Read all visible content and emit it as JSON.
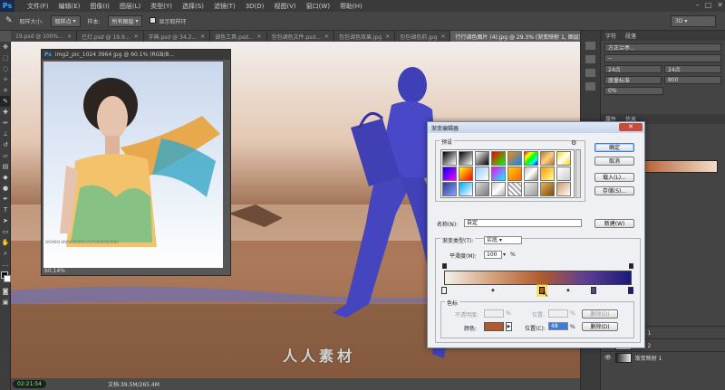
{
  "app": {
    "logo": "Ps"
  },
  "menu": [
    "文件(F)",
    "编辑(E)",
    "图像(I)",
    "图层(L)",
    "类型(Y)",
    "选择(S)",
    "滤镜(T)",
    "3D(D)",
    "视图(V)",
    "窗口(W)",
    "帮助(H)"
  ],
  "window_controls": [
    "–",
    "□",
    "✕"
  ],
  "options_bar": {
    "sample_size_label": "取样大小:",
    "sample_size_value": "取样点",
    "sample_label": "样本:",
    "sample_value": "所有图层",
    "show_ring_label": "显示取样环",
    "workspace_value": "3D"
  },
  "tabs": [
    {
      "label": "19.psd @ 100%..."
    },
    {
      "label": "已灯.psd @ 19.9..."
    },
    {
      "label": "字典.psd @ 34.2..."
    },
    {
      "label": "调色工具.psd..."
    },
    {
      "label": "包包调色文件.psd..."
    },
    {
      "label": "包包调色效果.jpg"
    },
    {
      "label": "包包调色前.jpg"
    },
    {
      "label": "行行调色图片 (4).jpg @ 29.3% (渐变映射 1, 图层蒙版/8)"
    }
  ],
  "floating_doc": {
    "title": "img2_pic_1024 3964 jpg @ 60.1% (RGB/8...",
    "zoom": "60.14%",
    "caption": "WOMEN WWW.WOMO.CC/FASHION/2685"
  },
  "status": {
    "time": "02:21:54",
    "doc_info": "文档:39.5M/265.4M"
  },
  "gradient_editor": {
    "title": "渐变编辑器",
    "presets_label": "预设",
    "ok": "确定",
    "cancel": "取消",
    "load": "载入(L)...",
    "save": "存储(S)...",
    "name_label": "名称(N):",
    "name_value": "自定",
    "new_button": "新建(W)",
    "type_label": "渐变类型(T):",
    "type_value": "实底",
    "smooth_label": "平滑度(M):",
    "smooth_value": "100",
    "smooth_unit": "%",
    "stops_label": "色标",
    "opacity_label": "不透明度:",
    "opacity_unit": "%",
    "location_label": "位置:",
    "location_unit": "%",
    "delete_label": "删除(D)",
    "color_label": "颜色:",
    "color_location_label": "位置(C):",
    "color_location_value": "48",
    "color_location_unit": "%",
    "color_delete_label": "删除(D)",
    "stop_color": "#b05a2e"
  },
  "right_panel": {
    "tabs": [
      "字符",
      "段落"
    ],
    "tabs2": [
      "属性",
      "信息"
    ],
    "fields": [
      "方正兰亭...",
      "--",
      "24点",
      "24点",
      "度量标准",
      "800",
      "0%"
    ],
    "layers": [
      {
        "name": "图层 1"
      },
      {
        "name": "图层 2"
      },
      {
        "name": "渐变映射 1"
      }
    ]
  },
  "watermark": "人人素材",
  "colors": {
    "accent": "#3d7bd6",
    "bg": "#535353",
    "dialog": "#eef0f3"
  }
}
